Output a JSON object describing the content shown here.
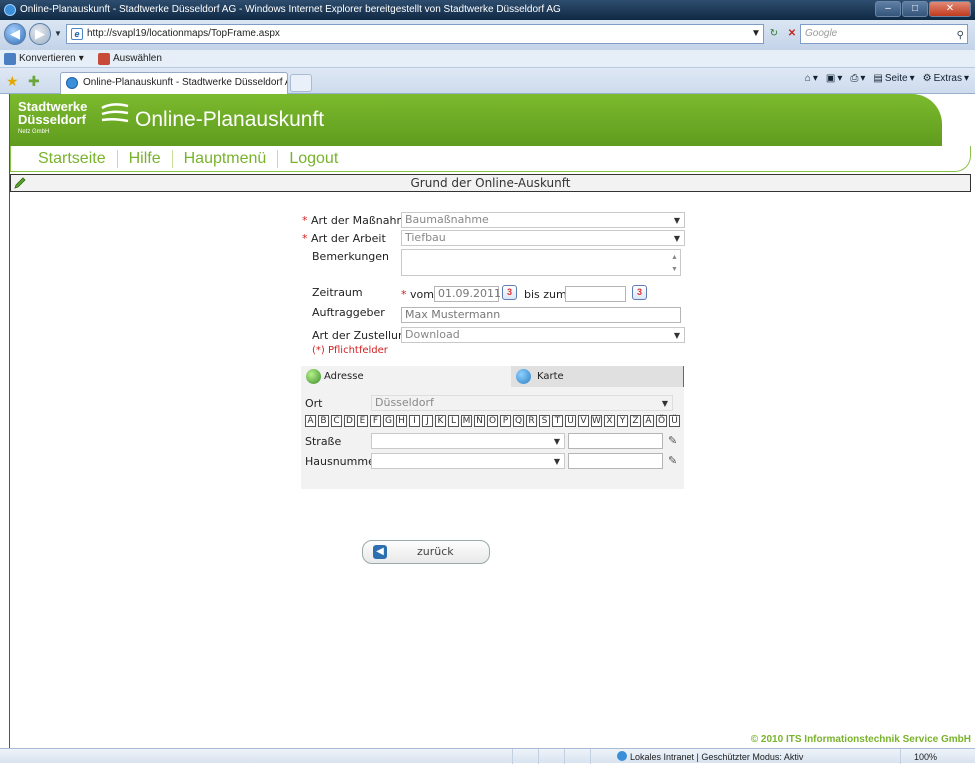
{
  "browser": {
    "title": "Online-Planauskunft - Stadtwerke Düsseldorf AG - Windows Internet Explorer bereitgestellt von Stadtwerke Düsseldorf AG",
    "address": "http://svapl19/locationmaps/TopFrame.aspx",
    "search_placeholder": "Google",
    "links": {
      "convert": "Konvertieren",
      "select": "Auswählen"
    },
    "tab_title": "Online-Planauskunft - Stadtwerke Düsseldorf AG",
    "commands": {
      "page": "Seite",
      "extras": "Extras"
    },
    "status_zone": "Lokales Intranet | Geschützter Modus: Aktiv",
    "status_zoom": "100%"
  },
  "brand": {
    "logo_line1": "Stadtwerke",
    "logo_line2": "Düsseldorf",
    "logo_line3": "Netz GmbH",
    "title": "Online-Planauskunft"
  },
  "menu": [
    "Startseite",
    "Hilfe",
    "Hauptmenü",
    "Logout"
  ],
  "section_title": "Grund der Online-Auskunft",
  "form": {
    "measure_label": "Art der Maßnahme",
    "measure_value": "Baumaßnahme",
    "work_label": "Art der Arbeit",
    "work_value": "Tiefbau",
    "remarks_label": "Bemerkungen",
    "period_label": "Zeitraum",
    "from_label": "vom",
    "from_value": "01.09.2011",
    "to_label": "bis zum",
    "to_value": "",
    "client_label": "Auftraggeber",
    "client_value": "Max Mustermann",
    "delivery_label": "Art der Zustellung",
    "delivery_value": "Download",
    "required_note": "(*) Pflichtfelder"
  },
  "search_panel": {
    "tabs": [
      "Adresse",
      "Karte"
    ],
    "city_label": "Ort",
    "city_value": "Düsseldorf",
    "letters": [
      "A",
      "B",
      "C",
      "D",
      "E",
      "F",
      "G",
      "H",
      "I",
      "J",
      "K",
      "L",
      "M",
      "N",
      "O",
      "P",
      "Q",
      "R",
      "S",
      "T",
      "U",
      "V",
      "W",
      "X",
      "Y",
      "Z",
      "Ä",
      "Ö",
      "Ü"
    ],
    "street_label": "Straße",
    "house_label": "Hausnummer"
  },
  "back_button": "zurück",
  "footer": "© 2010 ITS Informationstechnik Service GmbH"
}
